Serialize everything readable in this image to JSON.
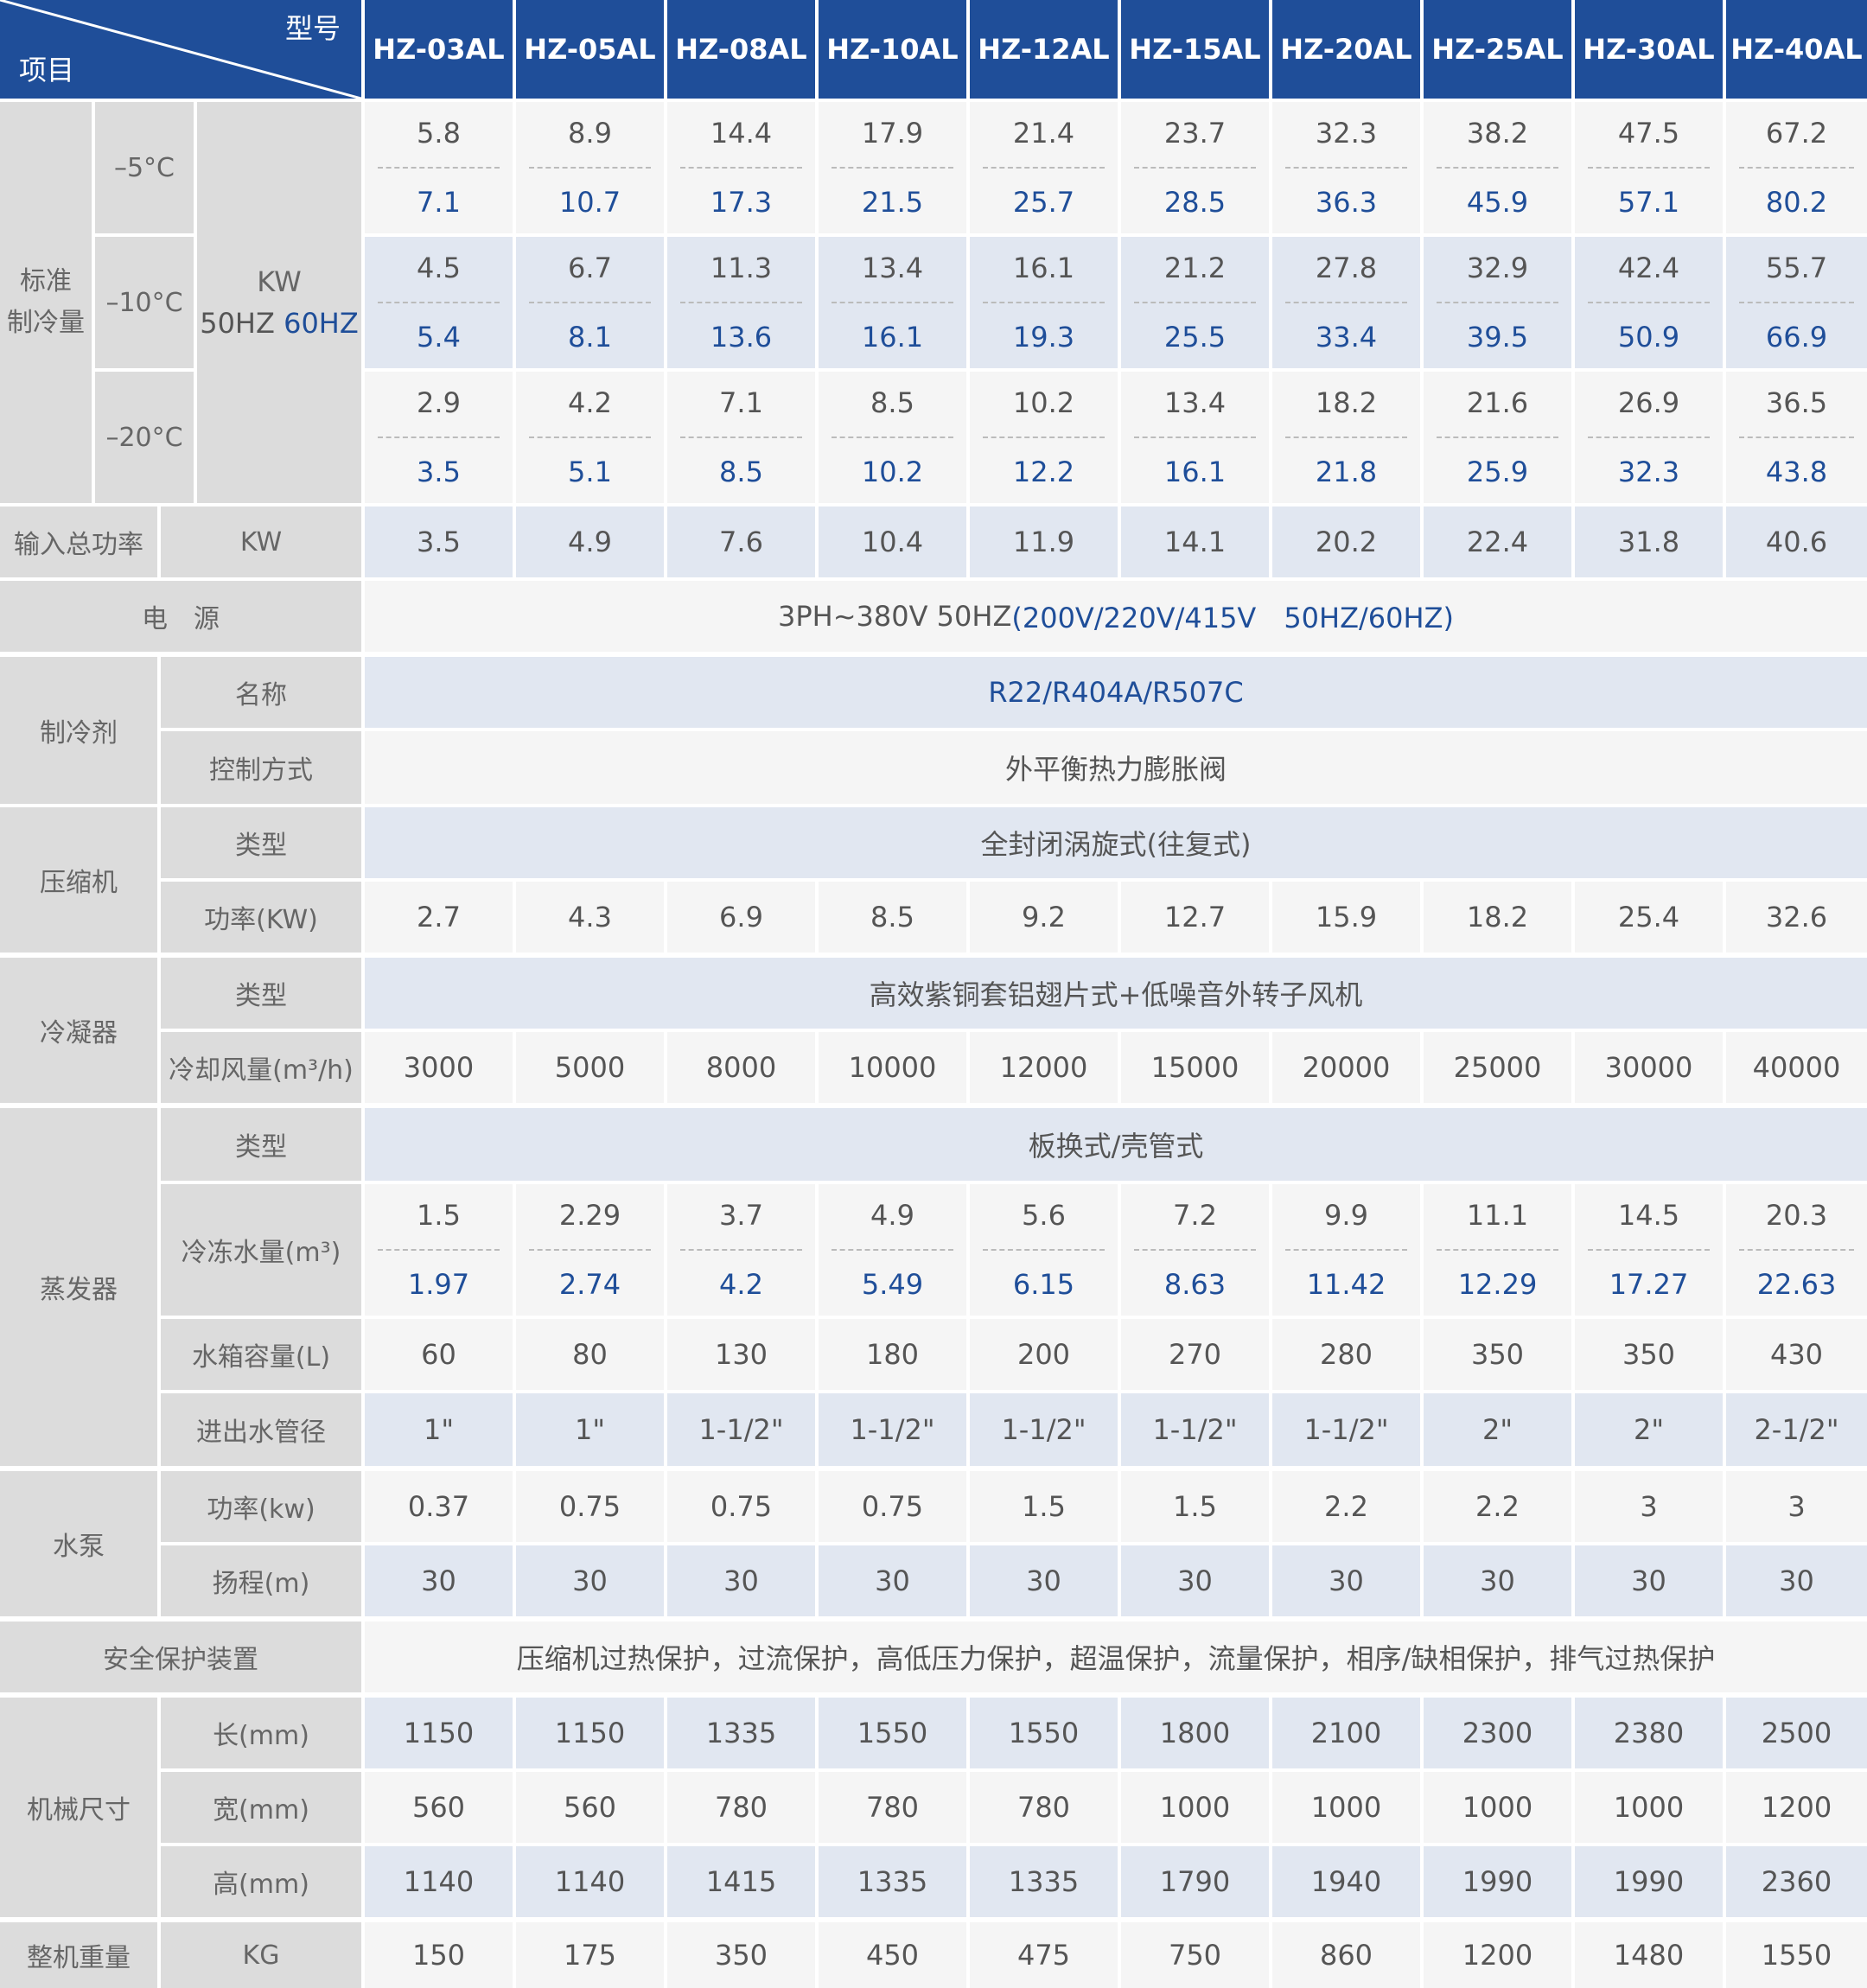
{
  "header": {
    "corner_model": "型号",
    "corner_item": "项目",
    "models": [
      "HZ-03AL",
      "HZ-05AL",
      "HZ-08AL",
      "HZ-10AL",
      "HZ-12AL",
      "HZ-15AL",
      "HZ-20AL",
      "HZ-25AL",
      "HZ-30AL",
      "HZ-40AL"
    ]
  },
  "cooling": {
    "label_line1": "标准",
    "label_line2": "制冷量",
    "unit_kw": "KW",
    "unit_50hz": "50HZ",
    "unit_60hz": "60HZ",
    "rows": [
      {
        "temp": "–5°C",
        "hz50": [
          "5.8",
          "8.9",
          "14.4",
          "17.9",
          "21.4",
          "23.7",
          "32.3",
          "38.2",
          "47.5",
          "67.2"
        ],
        "hz60": [
          "7.1",
          "10.7",
          "17.3",
          "21.5",
          "25.7",
          "28.5",
          "36.3",
          "45.9",
          "57.1",
          "80.2"
        ]
      },
      {
        "temp": "–10°C",
        "hz50": [
          "4.5",
          "6.7",
          "11.3",
          "13.4",
          "16.1",
          "21.2",
          "27.8",
          "32.9",
          "42.4",
          "55.7"
        ],
        "hz60": [
          "5.4",
          "8.1",
          "13.6",
          "16.1",
          "19.3",
          "25.5",
          "33.4",
          "39.5",
          "50.9",
          "66.9"
        ]
      },
      {
        "temp": "–20°C",
        "hz50": [
          "2.9",
          "4.2",
          "7.1",
          "8.5",
          "10.2",
          "13.4",
          "18.2",
          "21.6",
          "26.9",
          "36.5"
        ],
        "hz60": [
          "3.5",
          "5.1",
          "8.5",
          "10.2",
          "12.2",
          "16.1",
          "21.8",
          "25.9",
          "32.3",
          "43.8"
        ]
      }
    ]
  },
  "input_power": {
    "label": "输入总功率",
    "unit": "KW",
    "values": [
      "3.5",
      "4.9",
      "7.6",
      "10.4",
      "11.9",
      "14.1",
      "20.2",
      "22.4",
      "31.8",
      "40.6"
    ]
  },
  "power_supply": {
    "label": "电　源",
    "value_part1": "3PH~380V 50HZ",
    "value_part2": "(200V/220V/415V　50HZ/60HZ)"
  },
  "refrigerant": {
    "label": "制冷剂",
    "name_label": "名称",
    "name_value": "R22/R404A/R507C",
    "control_label": "控制方式",
    "control_value": "外平衡热力膨胀阀"
  },
  "compressor": {
    "label": "压缩机",
    "type_label": "类型",
    "type_value": "全封闭涡旋式(往复式)",
    "power_label": "功率(KW)",
    "power_values": [
      "2.7",
      "4.3",
      "6.9",
      "8.5",
      "9.2",
      "12.7",
      "15.9",
      "18.2",
      "25.4",
      "32.6"
    ]
  },
  "condenser": {
    "label": "冷凝器",
    "type_label": "类型",
    "type_value": "高效紫铜套铝翅片式+低噪音外转子风机",
    "air_label": "冷却风量(m³/h)",
    "air_values": [
      "3000",
      "5000",
      "8000",
      "10000",
      "12000",
      "15000",
      "20000",
      "25000",
      "30000",
      "40000"
    ]
  },
  "evaporator": {
    "label": "蒸发器",
    "type_label": "类型",
    "type_value": "板换式/壳管式",
    "water_label": "冷冻水量(m³)",
    "water_50": [
      "1.5",
      "2.29",
      "3.7",
      "4.9",
      "5.6",
      "7.2",
      "9.9",
      "11.1",
      "14.5",
      "20.3"
    ],
    "water_60": [
      "1.97",
      "2.74",
      "4.2",
      "5.49",
      "6.15",
      "8.63",
      "11.42",
      "12.29",
      "17.27",
      "22.63"
    ],
    "tank_label": "水箱容量(L)",
    "tank_values": [
      "60",
      "80",
      "130",
      "180",
      "200",
      "270",
      "280",
      "350",
      "350",
      "430"
    ],
    "pipe_label": "进出水管径",
    "pipe_values": [
      "1\"",
      "1\"",
      "1-1/2\"",
      "1-1/2\"",
      "1-1/2\"",
      "1-1/2\"",
      "1-1/2\"",
      "2\"",
      "2\"",
      "2-1/2\""
    ]
  },
  "pump": {
    "label": "水泵",
    "power_label": "功率(kw)",
    "power_values": [
      "0.37",
      "0.75",
      "0.75",
      "0.75",
      "1.5",
      "1.5",
      "2.2",
      "2.2",
      "3",
      "3"
    ],
    "head_label": "扬程(m)",
    "head_values": [
      "30",
      "30",
      "30",
      "30",
      "30",
      "30",
      "30",
      "30",
      "30",
      "30"
    ]
  },
  "safety": {
    "label": "安全保护装置",
    "value": "压缩机过热保护，过流保护，高低压力保护，超温保护，流量保护，相序/缺相保护，排气过热保护"
  },
  "dimensions": {
    "label": "机械尺寸",
    "length_label": "长(mm)",
    "length_values": [
      "1150",
      "1150",
      "1335",
      "1550",
      "1550",
      "1800",
      "2100",
      "2300",
      "2380",
      "2500"
    ],
    "width_label": "宽(mm)",
    "width_values": [
      "560",
      "560",
      "780",
      "780",
      "780",
      "1000",
      "1000",
      "1000",
      "1000",
      "1200"
    ],
    "height_label": "高(mm)",
    "height_values": [
      "1140",
      "1140",
      "1415",
      "1335",
      "1335",
      "1790",
      "1940",
      "1990",
      "1990",
      "2360"
    ]
  },
  "weight": {
    "label": "整机重量",
    "unit": "KG",
    "values": [
      "150",
      "175",
      "350",
      "450",
      "475",
      "750",
      "860",
      "1200",
      "1480",
      "1550"
    ]
  },
  "colors": {
    "header_blue": "#1f4e99",
    "label_grey": "#dcdcdc",
    "row_light": "#f5f5f5",
    "row_blue": "#e1e7f1"
  }
}
